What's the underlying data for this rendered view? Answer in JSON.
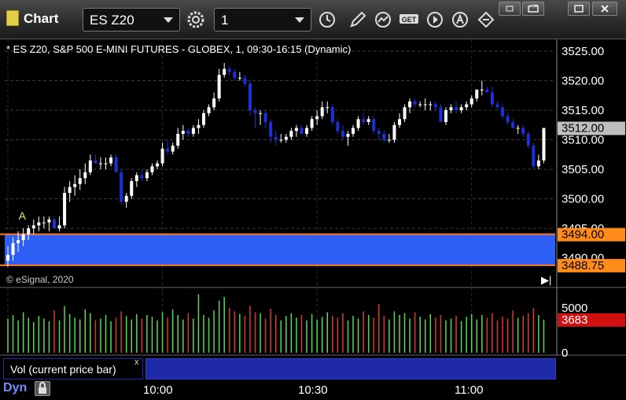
{
  "window": {
    "title": "Chart",
    "symbol": "ES Z20",
    "interval": "1",
    "controls": [
      "minimize",
      "restore",
      "maximize",
      "close"
    ]
  },
  "toolbar": {
    "icons": [
      "settings-icon",
      "clock-icon",
      "pencil-icon",
      "chart-study-icon",
      "get-icon",
      "play-icon",
      "alert-icon",
      "link-icon"
    ],
    "get_label": "GET"
  },
  "chart_info": "* ES Z20, S&P 500 E-MINI FUTURES - GLOBEX, 1, 09:30-16:15 (Dynamic)",
  "copyright": "© eSignal, 2020",
  "marker_label": "A",
  "price_axis": {
    "ticks": [
      "3525.00",
      "3520.00",
      "3515.00",
      "3510.00",
      "3505.00",
      "3500.00",
      "3495.00",
      "3490.00"
    ],
    "last_price": "3512.00",
    "upper_level": "3494.00",
    "lower_level": "3488.75"
  },
  "volume_panel": {
    "label": "Vol (current price bar)",
    "close_glyph": "x",
    "ticks": [
      "5000",
      "0"
    ],
    "current_volume": "3683"
  },
  "time_axis": {
    "ticks": [
      "10:00",
      "10:30",
      "11:00"
    ]
  },
  "status": {
    "mode": "Dyn"
  },
  "colors": {
    "up_candle": "#ffffff",
    "down_candle": "#1f2fd6",
    "band_fill": "#2d5ff5",
    "band_border": "#ff7a1a",
    "last_price_bg": "#bfbfbf",
    "level_label_bg": "#ff8c1a",
    "volume_up": "#57d85a",
    "volume_down": "#d83a2a",
    "volume_label_bg": "#d01010"
  },
  "chart_data": {
    "type": "candlestick",
    "title": "",
    "ylim": [
      3487,
      3527
    ],
    "x": [
      "09:30",
      "09:31",
      "09:32",
      "09:33",
      "09:34",
      "09:35",
      "09:36",
      "09:37",
      "09:38",
      "09:39",
      "09:40",
      "09:41",
      "09:42",
      "09:43",
      "09:44",
      "09:45",
      "09:46",
      "09:47",
      "09:48",
      "09:49",
      "09:50",
      "09:51",
      "09:52",
      "09:53",
      "09:54",
      "09:55",
      "09:56",
      "09:57",
      "09:58",
      "09:59",
      "10:00",
      "10:01",
      "10:02",
      "10:03",
      "10:04",
      "10:05",
      "10:06",
      "10:07",
      "10:08",
      "10:09",
      "10:10",
      "10:11",
      "10:12",
      "10:13",
      "10:14",
      "10:15",
      "10:16",
      "10:17",
      "10:18",
      "10:19",
      "10:20",
      "10:21",
      "10:22",
      "10:23",
      "10:24",
      "10:25",
      "10:26",
      "10:27",
      "10:28",
      "10:29",
      "10:30",
      "10:31",
      "10:32",
      "10:33",
      "10:34",
      "10:35",
      "10:36",
      "10:37",
      "10:38",
      "10:39",
      "10:40",
      "10:41",
      "10:42",
      "10:43",
      "10:44",
      "10:45",
      "10:46",
      "10:47",
      "10:48",
      "10:49",
      "10:50",
      "10:51",
      "10:52",
      "10:53",
      "10:54",
      "10:55",
      "10:56",
      "10:57",
      "10:58",
      "10:59",
      "11:00",
      "11:01",
      "11:02",
      "11:03",
      "11:04",
      "11:05",
      "11:06",
      "11:07",
      "11:08",
      "11:09",
      "11:10",
      "11:11",
      "11:12",
      "11:13",
      "11:14"
    ],
    "open": [
      3489.5,
      3490.5,
      3492.5,
      3493.0,
      3494.0,
      3495.0,
      3495.5,
      3496.0,
      3496.0,
      3496.5,
      3495.0,
      3495.5,
      3501.0,
      3502.0,
      3502.5,
      3503.5,
      3504.5,
      3506.5,
      3506.0,
      3506.0,
      3506.0,
      3507.0,
      3504.5,
      3499.5,
      3500.5,
      3503.0,
      3504.0,
      3503.5,
      3504.5,
      3505.5,
      3506.0,
      3508.5,
      3508.0,
      3509.0,
      3511.0,
      3511.5,
      3511.0,
      3512.0,
      3512.5,
      3514.5,
      3515.5,
      3517.0,
      3521.0,
      3522.0,
      3521.5,
      3520.5,
      3520.5,
      3519.5,
      3515.0,
      3514.5,
      3514.5,
      3513.0,
      3510.5,
      3510.0,
      3510.0,
      3510.5,
      3511.5,
      3512.0,
      3511.0,
      3512.0,
      3513.5,
      3514.0,
      3515.5,
      3515.5,
      3513.0,
      3511.5,
      3510.5,
      3511.0,
      3512.0,
      3513.5,
      3513.0,
      3513.5,
      3511.5,
      3511.0,
      3510.0,
      3510.0,
      3512.5,
      3513.5,
      3515.5,
      3516.5,
      3516.0,
      3516.0,
      3516.0,
      3516.0,
      3515.5,
      3513.0,
      3515.0,
      3515.5,
      3515.0,
      3515.5,
      3516.0,
      3517.0,
      3518.5,
      3518.5,
      3518.0,
      3516.0,
      3515.5,
      3514.0,
      3513.0,
      3512.0,
      3512.0,
      3511.0,
      3509.0,
      3505.5,
      3506.5
    ],
    "high": [
      3492.0,
      3493.5,
      3494.5,
      3495.0,
      3495.5,
      3496.5,
      3497.0,
      3497.0,
      3497.0,
      3497.0,
      3497.0,
      3502.0,
      3503.0,
      3504.0,
      3505.0,
      3506.0,
      3507.5,
      3507.5,
      3507.0,
      3507.0,
      3507.5,
      3507.5,
      3505.0,
      3501.0,
      3503.5,
      3504.5,
      3505.0,
      3505.0,
      3506.0,
      3506.5,
      3509.5,
      3510.0,
      3509.5,
      3512.0,
      3512.5,
      3512.0,
      3512.5,
      3513.5,
      3515.0,
      3516.0,
      3518.0,
      3522.0,
      3523.0,
      3522.5,
      3522.0,
      3521.5,
      3521.0,
      3520.0,
      3515.5,
      3515.0,
      3515.0,
      3513.5,
      3511.5,
      3511.0,
      3511.0,
      3512.0,
      3512.5,
      3512.5,
      3512.5,
      3514.0,
      3515.0,
      3516.5,
      3516.5,
      3516.0,
      3513.5,
      3512.5,
      3511.5,
      3512.5,
      3514.0,
      3514.5,
      3514.0,
      3514.0,
      3512.0,
      3511.5,
      3511.0,
      3513.0,
      3514.5,
      3516.0,
      3517.0,
      3517.0,
      3516.5,
      3517.0,
      3516.5,
      3516.5,
      3516.0,
      3515.5,
      3516.0,
      3516.5,
      3516.0,
      3516.5,
      3517.5,
      3518.5,
      3520.0,
      3519.0,
      3519.0,
      3516.5,
      3516.0,
      3514.5,
      3513.5,
      3512.5,
      3512.5,
      3511.5,
      3509.5,
      3507.5,
      3510.0
    ],
    "low": [
      3488.5,
      3489.5,
      3491.0,
      3492.0,
      3493.0,
      3494.0,
      3494.5,
      3495.0,
      3494.5,
      3495.0,
      3494.5,
      3495.0,
      3499.5,
      3500.5,
      3501.5,
      3502.5,
      3504.0,
      3506.0,
      3505.0,
      3505.0,
      3505.5,
      3505.5,
      3499.0,
      3498.5,
      3500.0,
      3502.0,
      3503.0,
      3503.0,
      3504.0,
      3505.0,
      3505.5,
      3507.5,
      3507.5,
      3508.5,
      3510.0,
      3510.5,
      3510.5,
      3511.0,
      3512.0,
      3514.0,
      3515.0,
      3516.5,
      3520.5,
      3521.0,
      3520.0,
      3520.0,
      3519.0,
      3514.0,
      3512.0,
      3512.5,
      3512.0,
      3509.5,
      3509.0,
      3509.5,
      3509.5,
      3510.0,
      3510.5,
      3511.0,
      3510.5,
      3511.5,
      3512.5,
      3513.5,
      3514.5,
      3512.5,
      3511.0,
      3510.0,
      3509.0,
      3510.5,
      3511.5,
      3512.5,
      3512.5,
      3511.0,
      3510.0,
      3509.5,
      3509.5,
      3509.5,
      3512.0,
      3513.0,
      3514.5,
      3515.5,
      3515.5,
      3515.0,
      3515.0,
      3515.0,
      3513.0,
      3512.5,
      3514.5,
      3514.5,
      3514.5,
      3515.0,
      3515.5,
      3516.5,
      3517.5,
      3518.0,
      3515.5,
      3515.0,
      3513.5,
      3512.5,
      3512.0,
      3511.0,
      3510.5,
      3508.5,
      3505.0,
      3505.0,
      3506.0
    ],
    "close": [
      3490.5,
      3492.5,
      3493.0,
      3494.0,
      3495.0,
      3495.5,
      3496.0,
      3496.0,
      3496.5,
      3495.0,
      3495.5,
      3501.0,
      3502.0,
      3502.5,
      3503.5,
      3504.5,
      3506.5,
      3506.0,
      3506.0,
      3506.0,
      3507.0,
      3504.5,
      3499.5,
      3500.5,
      3503.0,
      3504.0,
      3503.5,
      3504.5,
      3505.5,
      3506.0,
      3508.5,
      3508.0,
      3509.0,
      3511.0,
      3511.5,
      3511.0,
      3512.0,
      3512.5,
      3514.5,
      3515.5,
      3517.0,
      3521.0,
      3522.0,
      3521.5,
      3520.5,
      3520.5,
      3519.5,
      3515.0,
      3514.5,
      3514.5,
      3513.0,
      3510.5,
      3510.0,
      3510.0,
      3510.5,
      3511.5,
      3512.0,
      3511.0,
      3512.0,
      3513.5,
      3514.0,
      3515.5,
      3515.5,
      3513.0,
      3511.5,
      3510.5,
      3511.0,
      3512.0,
      3513.5,
      3513.0,
      3513.5,
      3511.5,
      3511.0,
      3510.0,
      3510.0,
      3512.5,
      3513.5,
      3515.5,
      3516.5,
      3516.0,
      3516.0,
      3516.0,
      3516.0,
      3515.5,
      3513.0,
      3515.0,
      3515.5,
      3515.0,
      3515.5,
      3516.0,
      3517.0,
      3518.5,
      3518.5,
      3518.0,
      3516.0,
      3515.5,
      3514.0,
      3513.0,
      3512.0,
      3512.0,
      3511.0,
      3509.0,
      3505.5,
      3506.5,
      3512.0
    ],
    "volume": [
      3800,
      4200,
      3600,
      4500,
      3900,
      3400,
      4100,
      3800,
      3500,
      4700,
      3600,
      5200,
      4300,
      3900,
      3700,
      4800,
      4400,
      3600,
      3800,
      4200,
      3500,
      3900,
      4600,
      4100,
      3700,
      4300,
      3800,
      4200,
      4000,
      3600,
      4500,
      3900,
      4800,
      4200,
      3700,
      4400,
      3800,
      6500,
      4200,
      3900,
      4700,
      5800,
      6200,
      5000,
      4600,
      4300,
      4100,
      5200,
      4500,
      4400,
      3800,
      4900,
      4200,
      3600,
      4100,
      4400,
      3900,
      4200,
      3600,
      4300,
      3700,
      4000,
      4500,
      4100,
      3900,
      4400,
      3600,
      4100,
      3800,
      4600,
      4200,
      3900,
      5400,
      4100,
      3700,
      4600,
      4200,
      4400,
      3800,
      4500,
      4000,
      3700,
      4300,
      3900,
      4200,
      3600,
      3800,
      4100,
      3500,
      4000,
      4300,
      3700,
      4200,
      3900,
      4400,
      3600,
      4000,
      3800,
      4700,
      3900,
      4100,
      4400,
      5000,
      4200,
      3683
    ]
  }
}
